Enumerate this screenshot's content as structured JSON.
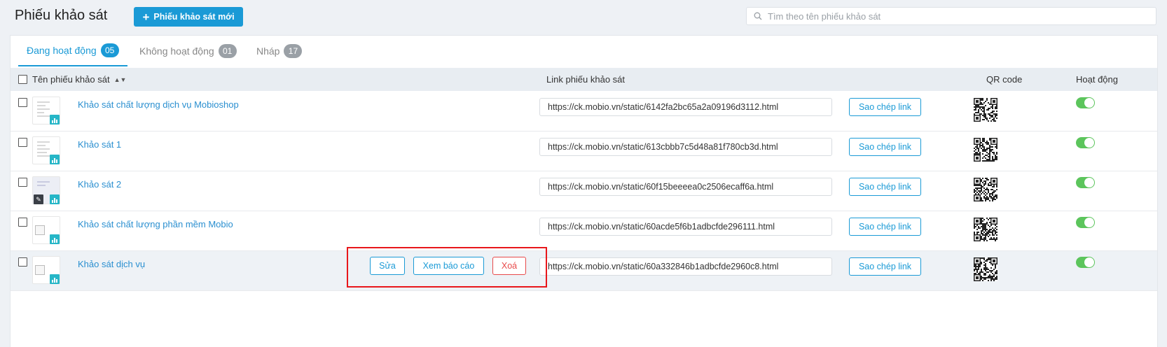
{
  "header": {
    "title": "Phiếu khảo sát",
    "new_button_label": "Phiếu khảo sát mới",
    "search_placeholder": "Tìm theo tên phiếu khảo sát"
  },
  "tabs": [
    {
      "label": "Đang hoạt động",
      "count": "05",
      "active": true
    },
    {
      "label": "Không hoạt động",
      "count": "01",
      "active": false
    },
    {
      "label": "Nháp",
      "count": "17",
      "active": false
    }
  ],
  "table": {
    "columns": {
      "name": "Tên phiếu khảo sát",
      "link": "Link phiếu khảo sát",
      "qr": "QR code",
      "active": "Hoạt động"
    },
    "copy_label": "Sao chép link",
    "rows": [
      {
        "name": "Khảo sát chất lượng dịch vụ Mobioshop",
        "link": "https://ck.mobio.vn/static/6142fa2bc65a2a09196d3112.html",
        "active": true
      },
      {
        "name": "Khảo sát 1",
        "link": "https://ck.mobio.vn/static/613cbbb7c5d48a81f780cb3d.html",
        "active": true
      },
      {
        "name": "Khảo sát 2",
        "link": "https://ck.mobio.vn/static/60f15beeeea0c2506ecaff6a.html",
        "active": true
      },
      {
        "name": "Khảo sát chất lượng phần mềm Mobio",
        "link": "https://ck.mobio.vn/static/60acde5f6b1adbcfde296111.html",
        "active": true
      },
      {
        "name": "Khảo sát dịch vụ",
        "link": "https://ck.mobio.vn/static/60a332846b1adbcfde2960c8.html",
        "active": true
      }
    ]
  },
  "row_actions": {
    "edit": "Sửa",
    "report": "Xem báo cáo",
    "delete": "Xoá"
  },
  "colors": {
    "accent": "#1a9ad6",
    "toggle_on": "#5cc55c",
    "danger": "#e84a4a",
    "highlight_box": "#e8171b"
  }
}
